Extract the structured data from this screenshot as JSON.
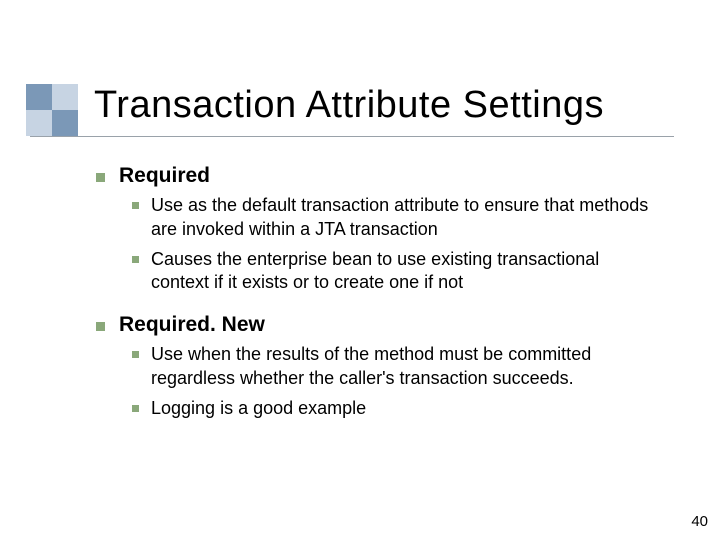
{
  "title": "Transaction Attribute Settings",
  "sections": [
    {
      "heading": "Required",
      "items": [
        "Use as the default transaction attribute to ensure that methods are invoked within a JTA transaction",
        "Causes the enterprise bean to use existing transactional context if it exists or to create one if not"
      ]
    },
    {
      "heading": "Required. New",
      "items": [
        "Use when the results of the method must be committed regardless whether the caller's transaction succeeds.",
        "Logging is a good example"
      ]
    }
  ],
  "page_number": "40",
  "colors": {
    "bullet": "#8aa87a",
    "deco_dark": "#7b98b7",
    "deco_light": "#c7d4e3"
  }
}
